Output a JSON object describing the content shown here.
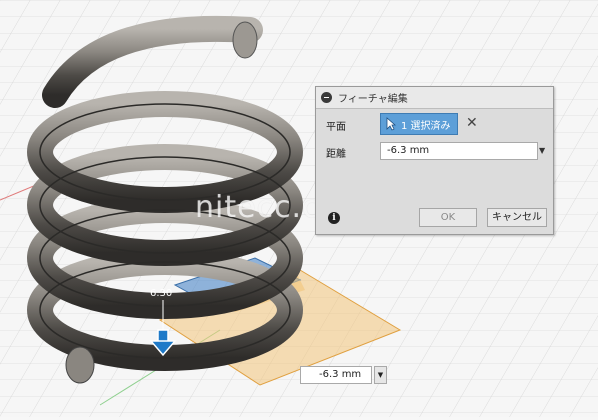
{
  "panel": {
    "title": "フィーチャ編集",
    "plane_label": "平面",
    "selection_text": "1 選択済み",
    "distance_label": "距離",
    "distance_value": "-6.3 mm",
    "ok_label": "OK",
    "cancel_label": "キャンセル"
  },
  "viewport": {
    "float_distance_value": "-6.3 mm",
    "dimension_text": "6.30",
    "watermark": "nitecc.co.jp"
  }
}
